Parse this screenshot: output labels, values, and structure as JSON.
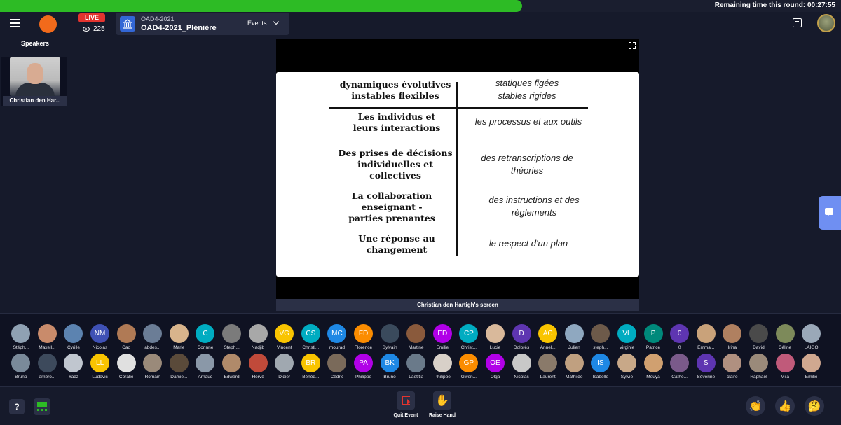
{
  "timer": {
    "text": "Remaining time this round: 00:27:55"
  },
  "header": {
    "live_label": "LIVE",
    "viewers": "225",
    "event_subtitle": "OAD4-2021",
    "event_title": "OAD4-2021_Plénière",
    "events_label": "Events"
  },
  "speakers": {
    "label": "Speakers",
    "items": [
      {
        "name": "Christian den Har..."
      }
    ]
  },
  "screen": {
    "caption": "Christian den Hartigh's screen",
    "slide": {
      "left": [
        "dynamiques évolutives\ninstables flexibles",
        "Les individus et\nleurs interactions",
        "Des prises de décisions\nindividuelles et\ncollectives",
        "La collaboration\nenseignant -\nparties prenantes",
        "Une réponse au\nchangement"
      ],
      "right": [
        "statiques figées\nstables rigides",
        "les processus et aux outils",
        "des retranscriptions de\nthéories",
        "des instructions et des\nrèglements",
        "le respect d'un plan"
      ]
    }
  },
  "participants": {
    "row1": [
      {
        "name": "Stéph...",
        "initials": "",
        "color": "#8fa1b3"
      },
      {
        "name": "Maxell...",
        "initials": "",
        "color": "#c98b6b"
      },
      {
        "name": "Cyrille",
        "initials": "",
        "color": "#5c83b0"
      },
      {
        "name": "Nicolas",
        "initials": "NM",
        "color": "#3f51b5"
      },
      {
        "name": "Cao",
        "initials": "",
        "color": "#b07a55"
      },
      {
        "name": "abdes...",
        "initials": "",
        "color": "#6b7d96"
      },
      {
        "name": "Marie",
        "initials": "",
        "color": "#d8b48c"
      },
      {
        "name": "Corinne",
        "initials": "C",
        "color": "#00acc1"
      },
      {
        "name": "Steph...",
        "initials": "",
        "color": "#7b7b7b"
      },
      {
        "name": "Nadjib",
        "initials": "",
        "color": "#a8a8a8"
      },
      {
        "name": "Vincent",
        "initials": "VG",
        "color": "#f9c400"
      },
      {
        "name": "Christi...",
        "initials": "CS",
        "color": "#00acc1"
      },
      {
        "name": "mourad",
        "initials": "MC",
        "color": "#1e88e5"
      },
      {
        "name": "Florence",
        "initials": "FD",
        "color": "#fb8c00"
      },
      {
        "name": "Sylvain",
        "initials": "",
        "color": "#3a4a5c"
      },
      {
        "name": "Martine",
        "initials": "",
        "color": "#8a5a3c"
      },
      {
        "name": "Emilie",
        "initials": "ED",
        "color": "#b100e8"
      },
      {
        "name": "Christ...",
        "initials": "CP",
        "color": "#00acc1"
      },
      {
        "name": "Lucie",
        "initials": "",
        "color": "#d9b99b"
      },
      {
        "name": "Dolorès",
        "initials": "D",
        "color": "#5e35b1"
      },
      {
        "name": "Annel...",
        "initials": "AC",
        "color": "#f9c400"
      },
      {
        "name": "Julien",
        "initials": "",
        "color": "#8fa8c0"
      },
      {
        "name": "steph...",
        "initials": "",
        "color": "#6d5a4a"
      },
      {
        "name": "Virginie",
        "initials": "VL",
        "color": "#00acc1"
      },
      {
        "name": "Patrice",
        "initials": "P",
        "color": "#00897b"
      },
      {
        "name": "0",
        "initials": "0",
        "color": "#5e35b1"
      },
      {
        "name": "Emma...",
        "initials": "",
        "color": "#c9a27a"
      },
      {
        "name": "Irina",
        "initials": "",
        "color": "#b08060"
      },
      {
        "name": "David",
        "initials": "",
        "color": "#4a4a4a"
      },
      {
        "name": "Céline",
        "initials": "",
        "color": "#7d8a5a"
      },
      {
        "name": "LAIGO",
        "initials": "",
        "color": "#9aa8b8"
      }
    ],
    "row2": [
      {
        "name": "Bruno",
        "initials": "",
        "color": "#7a8a9a"
      },
      {
        "name": "ambro...",
        "initials": "",
        "color": "#3d4a5c"
      },
      {
        "name": "Yadz",
        "initials": "",
        "color": "#c0c6cf"
      },
      {
        "name": "Ludovic",
        "initials": "LL",
        "color": "#f9c400"
      },
      {
        "name": "Coralie",
        "initials": "",
        "color": "#e0e0e0"
      },
      {
        "name": "Romain",
        "initials": "",
        "color": "#9a8a7a"
      },
      {
        "name": "Damie...",
        "initials": "",
        "color": "#5a4a3a"
      },
      {
        "name": "Arnaud",
        "initials": "",
        "color": "#8a98a8"
      },
      {
        "name": "Edward",
        "initials": "",
        "color": "#b08a6a"
      },
      {
        "name": "Hervé",
        "initials": "",
        "color": "#c04a3a"
      },
      {
        "name": "Didier",
        "initials": "",
        "color": "#a0a8b0"
      },
      {
        "name": "Bénéd...",
        "initials": "BR",
        "color": "#f9c400"
      },
      {
        "name": "Cédric",
        "initials": "",
        "color": "#7a6a5a"
      },
      {
        "name": "Philippe",
        "initials": "PA",
        "color": "#b100e8"
      },
      {
        "name": "Bruno",
        "initials": "BK",
        "color": "#1e88e5"
      },
      {
        "name": "Laetitia",
        "initials": "",
        "color": "#6a7a8a"
      },
      {
        "name": "Philippe",
        "initials": "",
        "color": "#d8d0c8"
      },
      {
        "name": "Gwen...",
        "initials": "GP",
        "color": "#fb8c00"
      },
      {
        "name": "Olga",
        "initials": "OE",
        "color": "#b100e8"
      },
      {
        "name": "Nicolas",
        "initials": "",
        "color": "#c8c8c8"
      },
      {
        "name": "Laurent",
        "initials": "",
        "color": "#8a7a6a"
      },
      {
        "name": "Mathilde",
        "initials": "",
        "color": "#c0a080"
      },
      {
        "name": "Isabelle",
        "initials": "IS",
        "color": "#1e88e5"
      },
      {
        "name": "Sylvie",
        "initials": "",
        "color": "#c8a888"
      },
      {
        "name": "Mouya",
        "initials": "",
        "color": "#d0a070"
      },
      {
        "name": "Cathe...",
        "initials": "",
        "color": "#7a5a8a"
      },
      {
        "name": "Séverine",
        "initials": "S",
        "color": "#5e35b1"
      },
      {
        "name": "claire",
        "initials": "",
        "color": "#b09080"
      },
      {
        "name": "Raphaël",
        "initials": "",
        "color": "#9a8a7a"
      },
      {
        "name": "Mija",
        "initials": "",
        "color": "#c05a7a"
      },
      {
        "name": "Emilie",
        "initials": "",
        "color": "#d0a890"
      }
    ]
  },
  "controls": {
    "help_label": "?",
    "quit_label": "Quit Event",
    "raise_label": "Raise Hand",
    "raise_glyph": "✋",
    "clap_glyph": "👏",
    "like_glyph": "👍",
    "think_glyph": "🤔"
  }
}
